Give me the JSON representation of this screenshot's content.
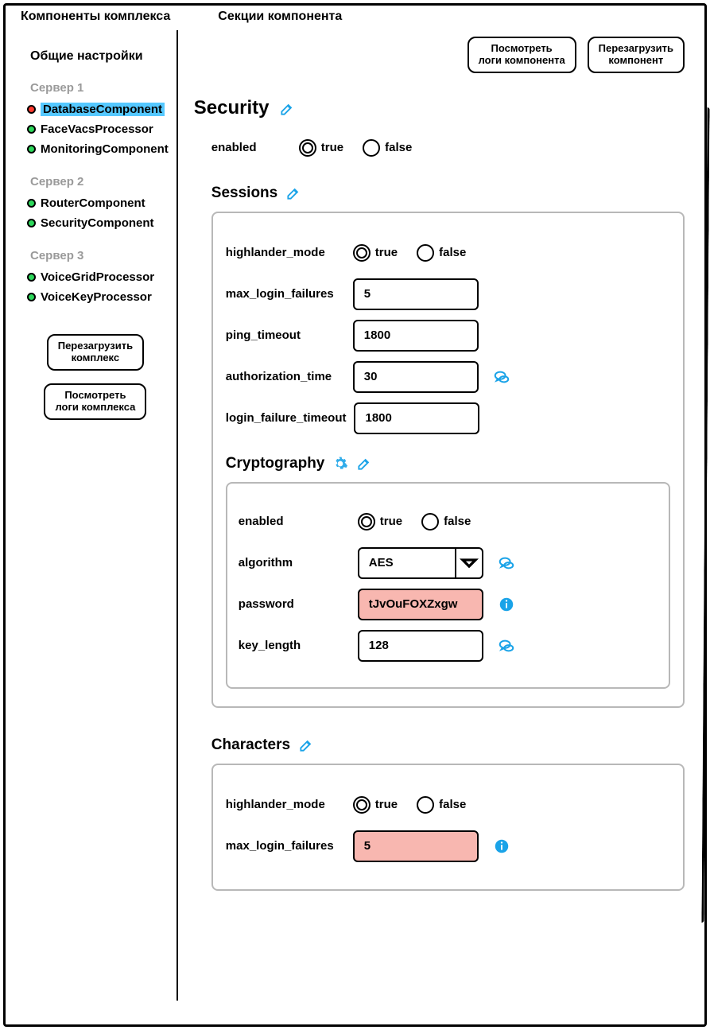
{
  "labels": {
    "components_col": "Компоненты комплекса",
    "sections_col": "Секции компонента"
  },
  "sidebar": {
    "general": "Общие настройки",
    "group1": "Сервер 1",
    "group2": "Сервер 2",
    "group3": "Сервер 3",
    "items1": {
      "0": {
        "name": "DatabaseComponent",
        "status": "red",
        "selected": true
      },
      "1": {
        "name": "FaceVacsProcessor",
        "status": "green"
      },
      "2": {
        "name": "MonitoringComponent",
        "status": "green"
      }
    },
    "items2": {
      "0": {
        "name": "RouterComponent",
        "status": "green"
      },
      "1": {
        "name": "SecurityComponent",
        "status": "green"
      }
    },
    "items3": {
      "0": {
        "name": "VoiceGridProcessor",
        "status": "green"
      },
      "1": {
        "name": "VoiceKeyProcessor",
        "status": "green"
      }
    },
    "btn_reload": "Перезагрузить\nкомплекс",
    "btn_logs": "Посмотреть\nлоги комплекса"
  },
  "toolbar": {
    "view_logs": "Посмотреть\nлоги компонента",
    "reload": "Перезагрузить\nкомпонент"
  },
  "security": {
    "title": "Security",
    "enabled_label": "enabled",
    "true": "true",
    "false": "false",
    "sessions": {
      "title": "Sessions",
      "highlander_label": "highlander_mode",
      "max_login_label": "max_login_failures",
      "max_login_value": "5",
      "ping_label": "ping_timeout",
      "ping_value": "1800",
      "auth_label": "authorization_time",
      "auth_value": "30",
      "lft_label": "login_failure_timeout",
      "lft_value": "1800"
    },
    "crypto": {
      "title": "Cryptography",
      "enabled_label": "enabled",
      "algo_label": "algorithm",
      "algo_value": "AES",
      "pwd_label": "password",
      "pwd_value": "tJvOuFOXZxgw",
      "keylen_label": "key_length",
      "keylen_value": "128"
    }
  },
  "characters": {
    "title": "Characters",
    "highlander_label": "highlander_mode",
    "max_login_label": "max_login_failures",
    "max_login_value": "5"
  },
  "colors": {
    "accent": "#1aa3e8"
  }
}
